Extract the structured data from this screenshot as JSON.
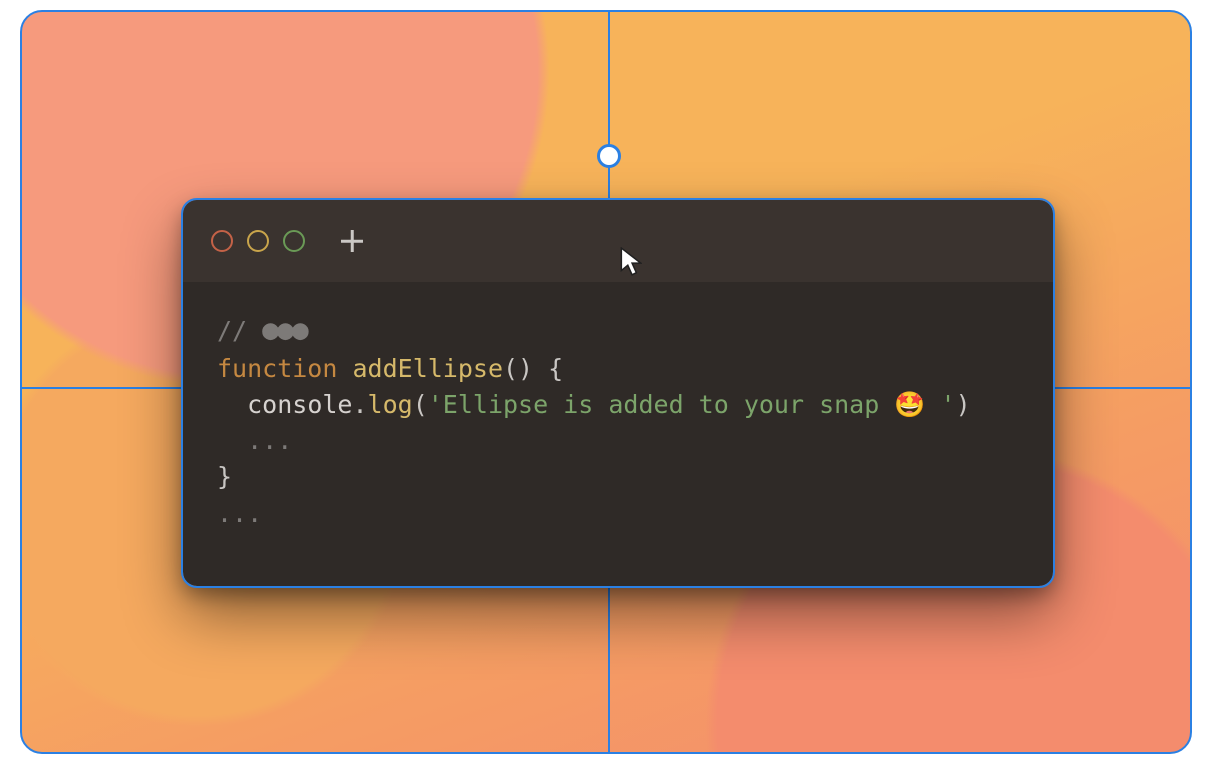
{
  "canvas": {
    "selection_color": "#2b80e3"
  },
  "window": {
    "traffic_lights": [
      "close",
      "minimize",
      "zoom"
    ],
    "new_tab_tooltip": "New Tab"
  },
  "code": {
    "comment_prefix": "// ",
    "keyword_function": "function",
    "func_name": "addEllipse",
    "open_paren": "() {",
    "console_obj": "console",
    "dot": ".",
    "log_method": "log",
    "call_open": "(",
    "string_literal": "'Ellipse is added to your snap 🤩 '",
    "call_close": ")",
    "ellipsis_inner": "...",
    "brace_close": "}",
    "ellipsis_outer": "..."
  }
}
